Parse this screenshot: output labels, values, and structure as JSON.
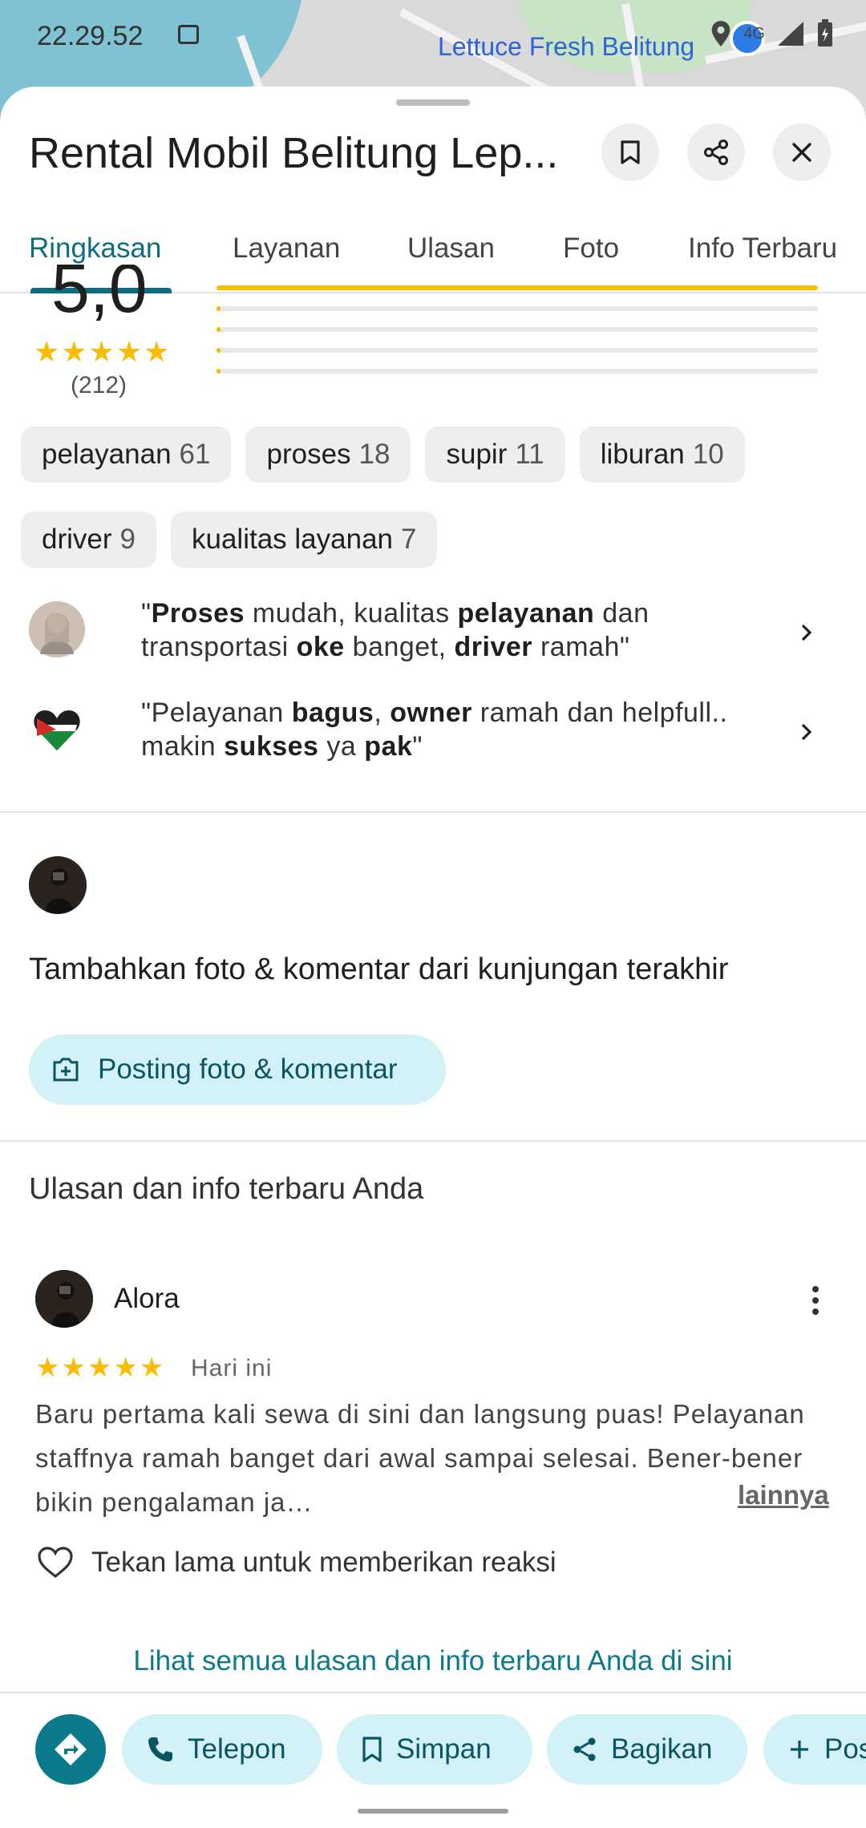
{
  "status_bar": {
    "time": "22.29.52",
    "map_label": "Lettuce Fresh Belitung",
    "signal_text": "4G"
  },
  "header": {
    "title": "Rental Mobil Belitung Lep...",
    "icons": [
      "bookmark-icon",
      "share-icon",
      "close-icon"
    ]
  },
  "tabs": [
    "Ringkasan",
    "Layanan",
    "Ulasan",
    "Foto",
    "Info Terbaru"
  ],
  "rating": {
    "score": "5,0",
    "stars": "★★★★★",
    "count": "(212)",
    "distribution": [
      1.0,
      0.0,
      0.0,
      0.0,
      0.0
    ]
  },
  "chips": [
    {
      "label": "pelayanan",
      "count": "61"
    },
    {
      "label": "proses",
      "count": "18"
    },
    {
      "label": "supir",
      "count": "11"
    },
    {
      "label": "liburan",
      "count": "10"
    },
    {
      "label": "driver",
      "count": "9"
    },
    {
      "label": "kualitas layanan",
      "count": "7"
    }
  ],
  "quotes": [
    {
      "parts": [
        [
          "\"",
          false
        ],
        [
          "Proses",
          true
        ],
        [
          " mudah, kualitas ",
          false
        ],
        [
          "pelayanan",
          true
        ],
        [
          " dan transportasi ",
          false
        ],
        [
          "oke",
          true
        ],
        [
          " banget, ",
          false
        ],
        [
          "driver",
          true
        ],
        [
          " ramah\"",
          false
        ]
      ]
    },
    {
      "parts": [
        [
          "\"Pelayanan ",
          false
        ],
        [
          "bagus",
          true
        ],
        [
          ", ",
          false
        ],
        [
          "owner",
          true
        ],
        [
          " ramah dan helpfull.. makin ",
          false
        ],
        [
          "sukses",
          true
        ],
        [
          " ya ",
          false
        ],
        [
          "pak",
          true
        ],
        [
          "\"",
          false
        ]
      ]
    }
  ],
  "add_prompt": {
    "title": "Tambahkan foto & komentar dari kunjungan terakhir",
    "button": "Posting foto & komentar"
  },
  "my_reviews": {
    "section_title": "Ulasan dan info terbaru Anda",
    "reviewer": "Alora",
    "stars": "★★★★★",
    "date": "Hari ini",
    "text": "Baru pertama kali sewa di sini dan langsung puas! Pelayanan staffnya ramah banget dari awal sampai selesai. Bener-bener bikin pengalaman ja…",
    "more_link": "lainnya",
    "react_label": "Tekan lama untuk memberikan reaksi",
    "see_all": "Lihat semua ulasan dan info terbaru Anda di sini"
  },
  "actions": {
    "call": "Telepon",
    "save": "Simpan",
    "share": "Bagikan",
    "post": "Pos"
  },
  "colors": {
    "accent": "#0b7a8a",
    "pill_bg": "#d3f2f8",
    "star": "#fbbc04"
  }
}
